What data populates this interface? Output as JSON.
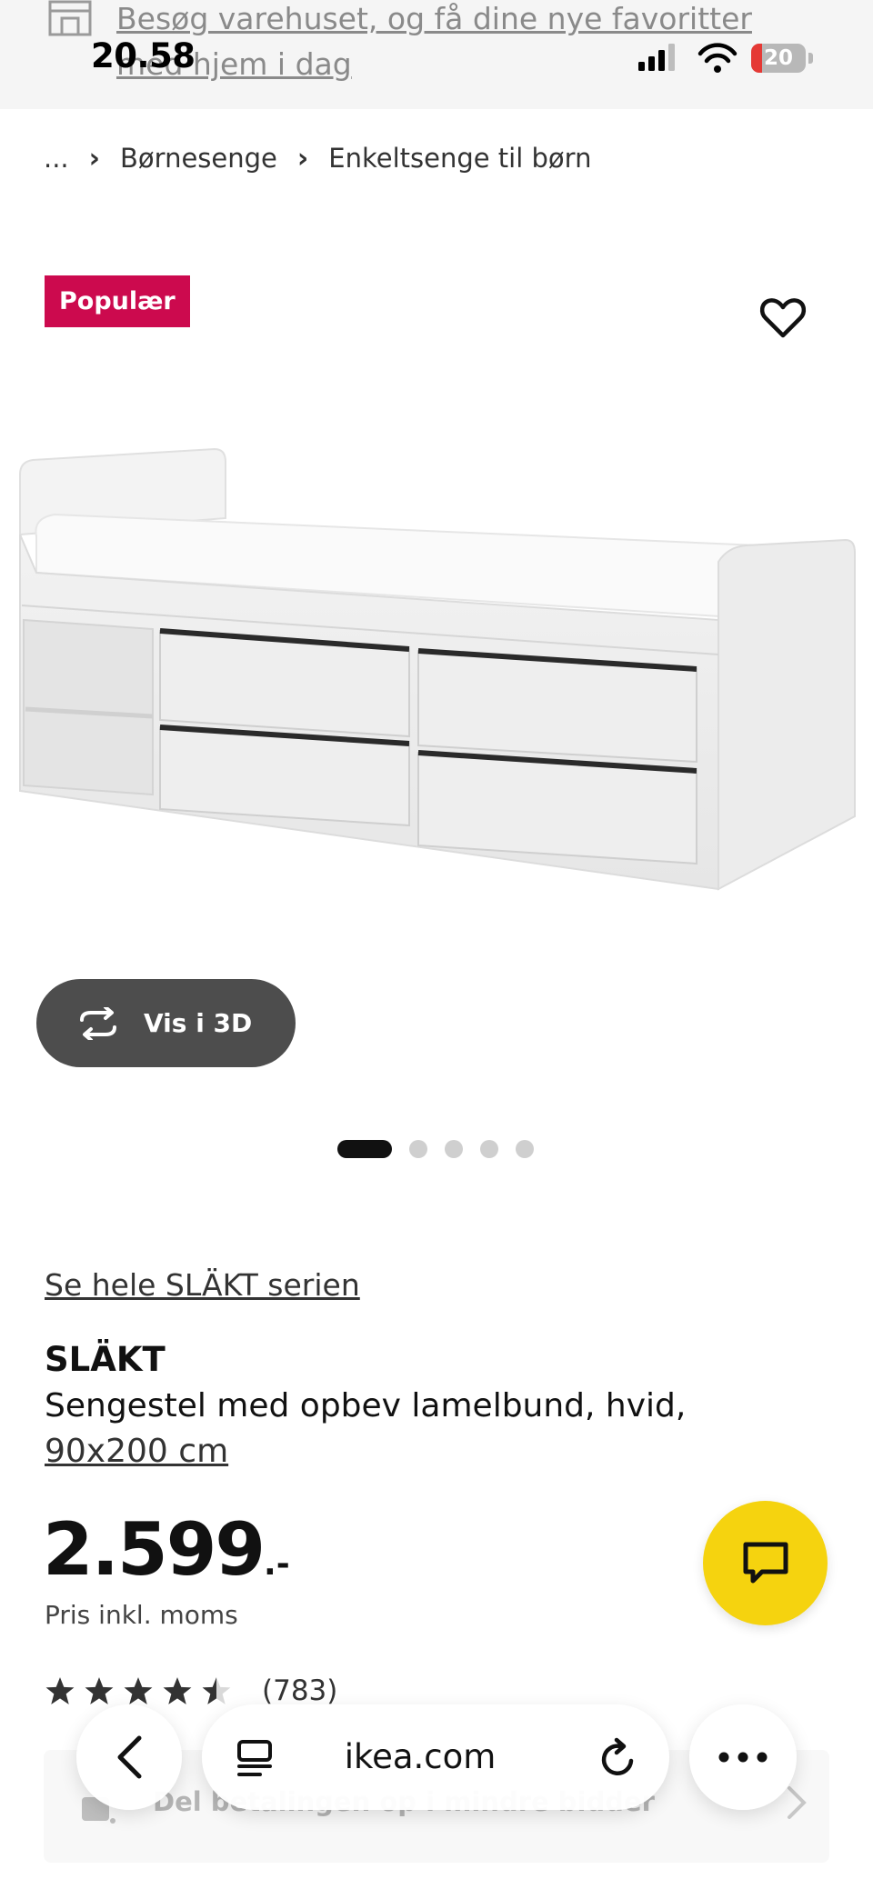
{
  "status_bar": {
    "time": "20.58",
    "battery_level": "20",
    "battery_fraction": 0.2
  },
  "promo": {
    "text": "Besøg varehuset, og få dine nye favoritter med hjem i dag",
    "icon": "store-icon"
  },
  "breadcrumb": {
    "ellipsis": "...",
    "items": [
      "Børnesenge",
      "Enkeltsenge til børn"
    ]
  },
  "product": {
    "badge": "Populær",
    "view_3d_label": "Vis i 3D",
    "carousel_total": 5,
    "carousel_active": 0,
    "series_link": "Se hele SLÄKT serien",
    "name": "SLÄKT",
    "description": "Sengestel med opbev lamelbund, hvid,",
    "size": "90x200 cm",
    "price_main": "2.599",
    "price_suffix": ".-",
    "price_note": "Pris inkl. moms",
    "rating_stars": 4.5,
    "rating_count": "(783)"
  },
  "payment_banner": {
    "text": "Del betalingen op i mindre bidder"
  },
  "browser": {
    "url": "ikea.com"
  },
  "colors": {
    "badge_bg": "#cc0a4e",
    "chat_button": "#f5d30f",
    "view3d_bg": "#4d4d4d"
  }
}
